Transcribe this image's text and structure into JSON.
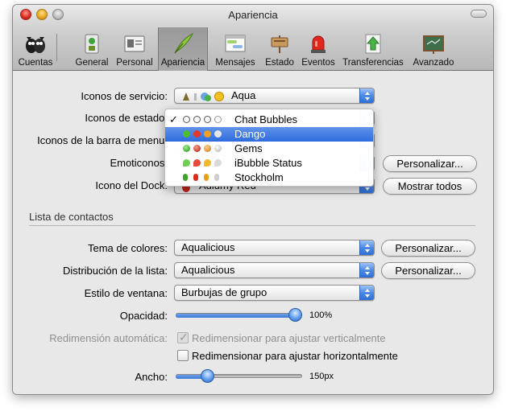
{
  "window": {
    "title": "Apariencia"
  },
  "toolbar": {
    "items": [
      {
        "label": "Cuentas"
      },
      {
        "label": "General"
      },
      {
        "label": "Personal"
      },
      {
        "label": "Apariencia"
      },
      {
        "label": "Mensajes"
      },
      {
        "label": "Estado"
      },
      {
        "label": "Eventos"
      },
      {
        "label": "Transferencias"
      },
      {
        "label": "Avanzado"
      }
    ],
    "selected": "Apariencia"
  },
  "form": {
    "service_icons": {
      "label": "Iconos de servicio:",
      "value": "Aqua"
    },
    "status_icons": {
      "label": "Iconos de estado:"
    },
    "menubar_icons": {
      "label": "Iconos de la barra de menu:"
    },
    "emoticons": {
      "label": "Emoticonos:",
      "button": "Personalizar..."
    },
    "dock_icon": {
      "label": "Icono del Dock:",
      "value": "Adiumy Red",
      "button": "Mostrar todos"
    }
  },
  "dropdown_menu": {
    "items": [
      {
        "label": "Chat Bubbles",
        "checked": true
      },
      {
        "label": "Dango",
        "highlighted": true
      },
      {
        "label": "Gems"
      },
      {
        "label": "iBubble Status"
      },
      {
        "label": "Stockholm"
      }
    ]
  },
  "contact_list": {
    "section_title": "Lista de contactos",
    "color_theme": {
      "label": "Tema de colores:",
      "value": "Aqualicious",
      "button": "Personalizar..."
    },
    "layout": {
      "label": "Distribución de la lista:",
      "value": "Aqualicious",
      "button": "Personalizar..."
    },
    "window_style": {
      "label": "Estilo de ventana:",
      "value": "Burbujas de grupo"
    },
    "opacity": {
      "label": "Opacidad:",
      "value_text": "100%",
      "value": 1.0
    },
    "auto_resize": {
      "label": "Redimensión automática:",
      "vertical": {
        "label": "Redimensionar para ajustar verticalmente",
        "checked": true,
        "enabled": false
      },
      "horizontal": {
        "label": "Redimensionar para ajustar horizontalmente",
        "checked": false,
        "enabled": true
      }
    },
    "width": {
      "label": "Ancho:",
      "value_text": "150px",
      "value": 0.22
    }
  }
}
